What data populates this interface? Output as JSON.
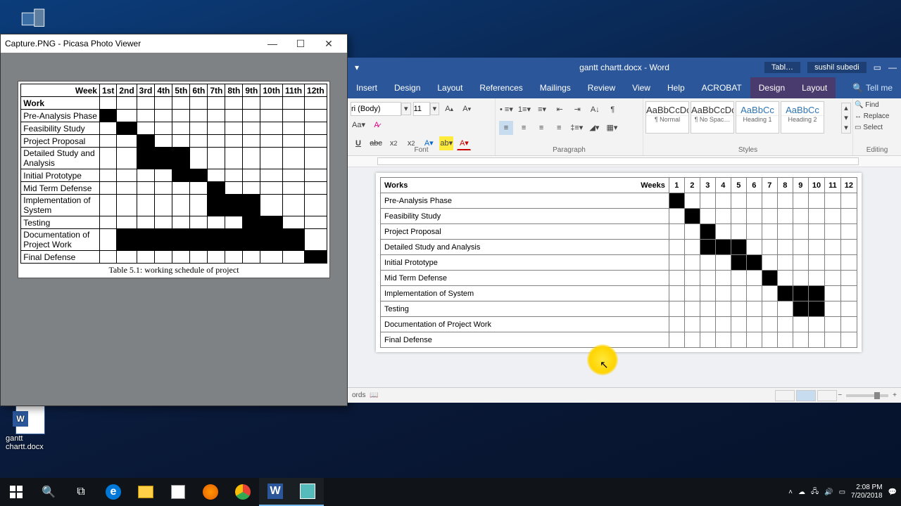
{
  "chart_data": [
    {
      "type": "bar",
      "name": "picasa_gantt",
      "title": "Table 5.1: working schedule of project",
      "xlabel": "Week",
      "x": [
        "1st",
        "2nd",
        "3rd",
        "4th",
        "5th",
        "6th",
        "7th",
        "8th",
        "9th",
        "10th",
        "11th",
        "12th"
      ],
      "series": [
        {
          "name": "Pre-Analysis Phase",
          "bars": [
            1
          ]
        },
        {
          "name": "Feasibility Study",
          "bars": [
            2
          ]
        },
        {
          "name": "Project Proposal",
          "bars": [
            3
          ]
        },
        {
          "name": "Detailed Study and Analysis",
          "bars": [
            3,
            4,
            5
          ]
        },
        {
          "name": "Initial Prototype",
          "bars": [
            5,
            6
          ]
        },
        {
          "name": "Mid Term Defense",
          "bars": [
            7
          ]
        },
        {
          "name": "Implementation of System",
          "bars": [
            7,
            8,
            9
          ]
        },
        {
          "name": "Testing",
          "bars": [
            9,
            10
          ]
        },
        {
          "name": "Documentation of Project Work",
          "bars": [
            2,
            3,
            4,
            5,
            6,
            7,
            8,
            9,
            10,
            11
          ]
        },
        {
          "name": "Final Defense",
          "bars": [
            12
          ]
        }
      ]
    },
    {
      "type": "bar",
      "name": "word_gantt",
      "xlabel": "Weeks",
      "x": [
        1,
        2,
        3,
        4,
        5,
        6,
        7,
        8,
        9,
        10,
        11,
        12
      ],
      "series": [
        {
          "name": "Pre-Analysis Phase",
          "bars": [
            1
          ]
        },
        {
          "name": "Feasibility Study",
          "bars": [
            2
          ]
        },
        {
          "name": "Project Proposal",
          "bars": [
            3
          ]
        },
        {
          "name": "Detailed Study and Analysis",
          "bars": [
            3,
            4,
            5
          ]
        },
        {
          "name": "Initial Prototype",
          "bars": [
            5,
            6
          ]
        },
        {
          "name": "Mid Term Defense",
          "bars": [
            7
          ]
        },
        {
          "name": "Implementation of System",
          "bars": [
            8,
            9,
            10
          ]
        },
        {
          "name": "Testing",
          "bars": [
            9,
            10
          ]
        },
        {
          "name": "Documentation of Project Work",
          "bars": []
        },
        {
          "name": "Final Defense",
          "bars": []
        }
      ]
    }
  ],
  "desktop": {
    "this_pc": "This PC",
    "file_icon_label": "gantt chartt.docx"
  },
  "picasa": {
    "title": "Capture.PNG - Picasa Photo Viewer",
    "table_corner": "Week",
    "row_axis": "Work",
    "caption": "Table 5.1: working schedule of project"
  },
  "word": {
    "title": "gantt chartt.docx - Word",
    "account": "sushil subedi",
    "context_tab": "Tabl…",
    "tabs": [
      "Insert",
      "Design",
      "Layout",
      "References",
      "Mailings",
      "Review",
      "View",
      "Help",
      "ACROBAT",
      "Design",
      "Layout"
    ],
    "tell_me": "Tell me",
    "search_icon": "🔍",
    "font_name": "ri (Body)",
    "font_size": "11",
    "groups": {
      "font": "Font",
      "para": "Paragraph",
      "styles": "Styles",
      "editing": "Editing"
    },
    "style_cards": [
      {
        "sample": "AaBbCcDc",
        "name": "¶ Normal"
      },
      {
        "sample": "AaBbCcDc",
        "name": "¶ No Spac…"
      },
      {
        "sample": "AaBbCc",
        "name": "Heading 1"
      },
      {
        "sample": "AaBbCc",
        "name": "Heading 2"
      }
    ],
    "editing": {
      "find": "Find",
      "replace": "Replace",
      "select": "Select"
    },
    "table_corner": "Works",
    "weeks_label": "Weeks",
    "status_words": "ords"
  },
  "taskbar": {
    "time": "2:08 PM",
    "date": "7/20/2018"
  }
}
